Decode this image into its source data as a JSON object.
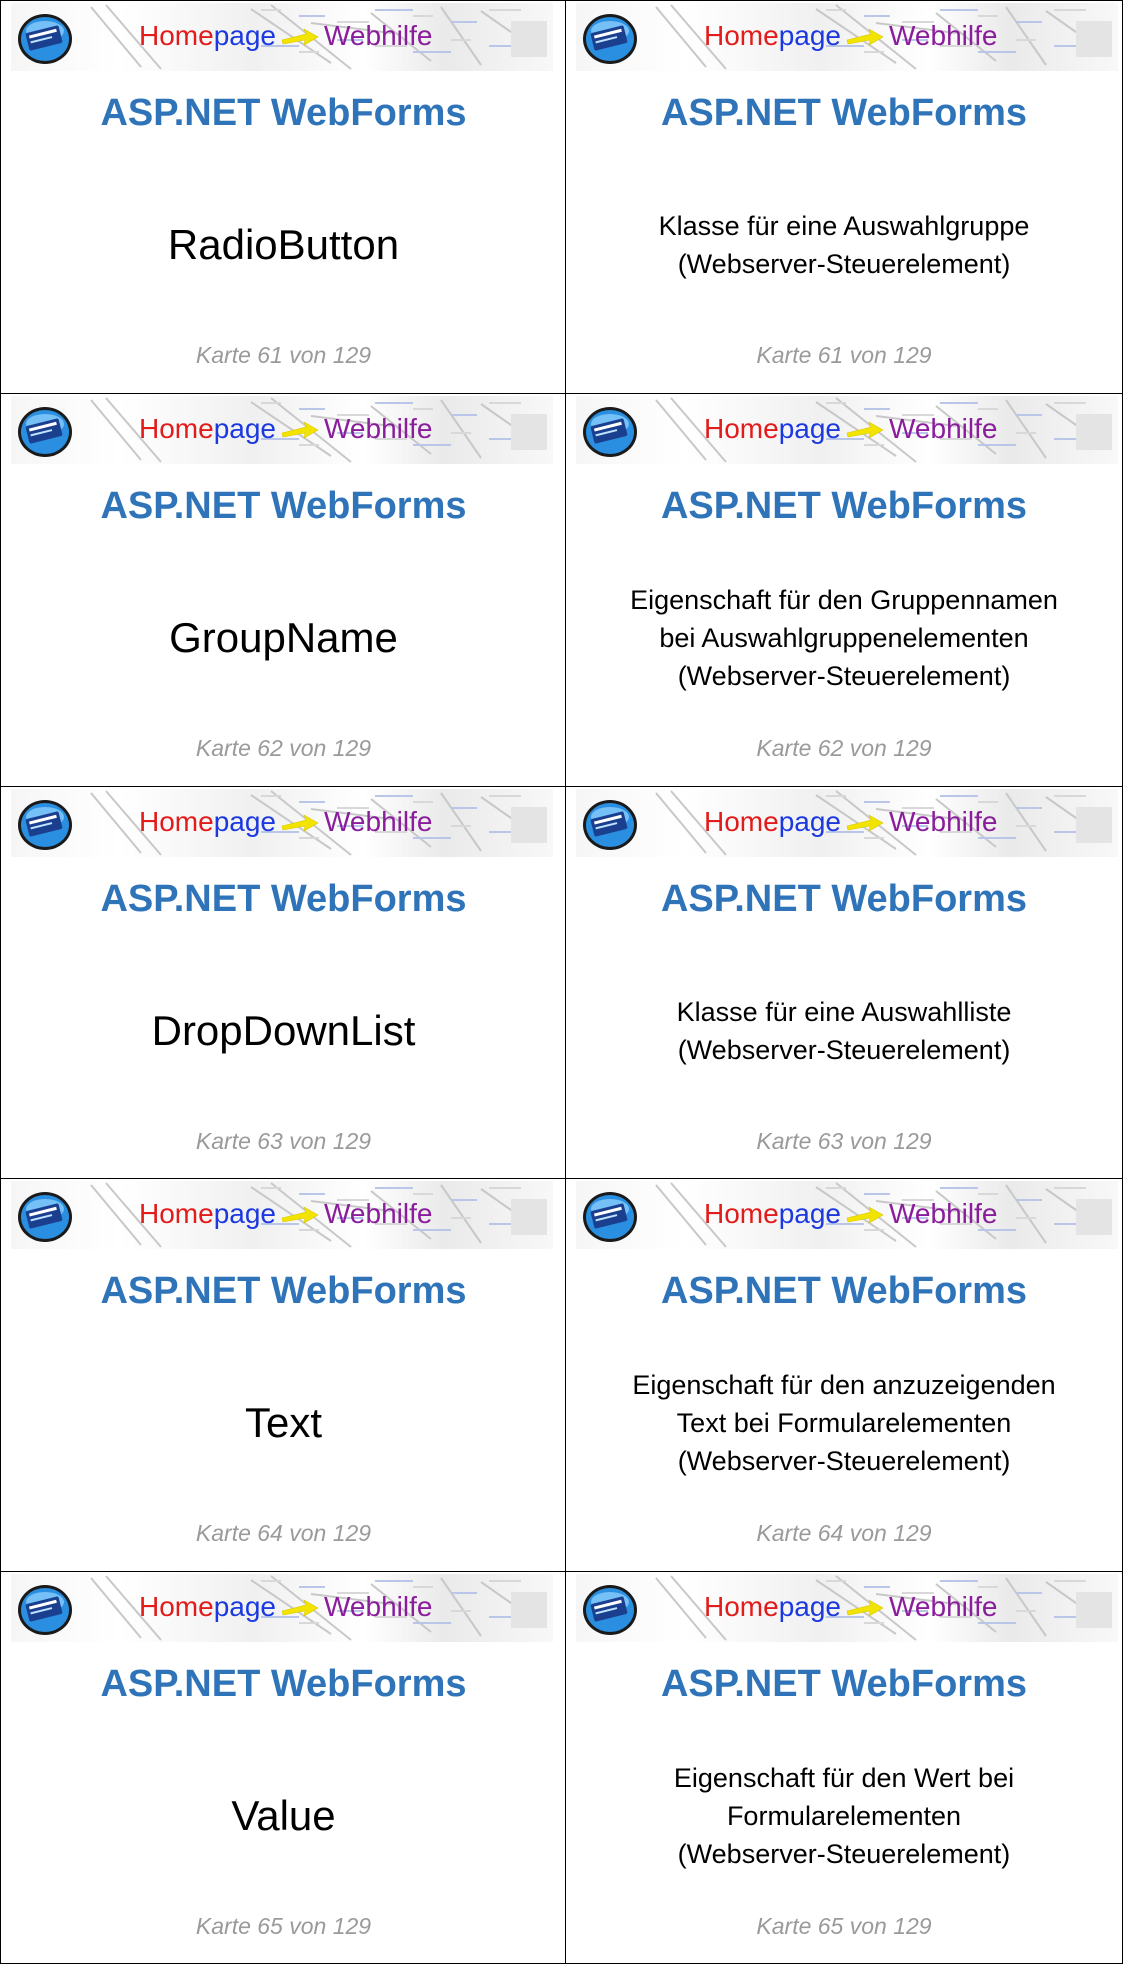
{
  "banner": {
    "home": "Home",
    "page": "page",
    "web": "Webhilfe"
  },
  "cards": [
    {
      "subject": "ASP.NET WebForms",
      "term": "RadioButton",
      "definition": [
        "Klasse für eine Auswahlgruppe",
        "(Webserver-Steuerelement)"
      ],
      "footer": "Karte 61 von 129"
    },
    {
      "subject": "ASP.NET WebForms",
      "term": "GroupName",
      "definition": [
        "Eigenschaft für den Gruppennamen",
        "bei Auswahlgruppenelementen",
        "(Webserver-Steuerelement)"
      ],
      "footer": "Karte 62 von 129"
    },
    {
      "subject": "ASP.NET WebForms",
      "term": "DropDownList",
      "definition": [
        "Klasse für eine Auswahlliste",
        "(Webserver-Steuerelement)"
      ],
      "footer": "Karte 63 von 129"
    },
    {
      "subject": "ASP.NET WebForms",
      "term": "Text",
      "definition": [
        "Eigenschaft für den anzuzeigenden",
        "Text bei Formularelementen",
        "(Webserver-Steuerelement)"
      ],
      "footer": "Karte 64 von 129"
    },
    {
      "subject": "ASP.NET WebForms",
      "term": "Value",
      "definition": [
        "Eigenschaft für den Wert bei",
        "Formularelementen",
        "(Webserver-Steuerelement)"
      ],
      "footer": "Karte 65 von 129"
    }
  ]
}
